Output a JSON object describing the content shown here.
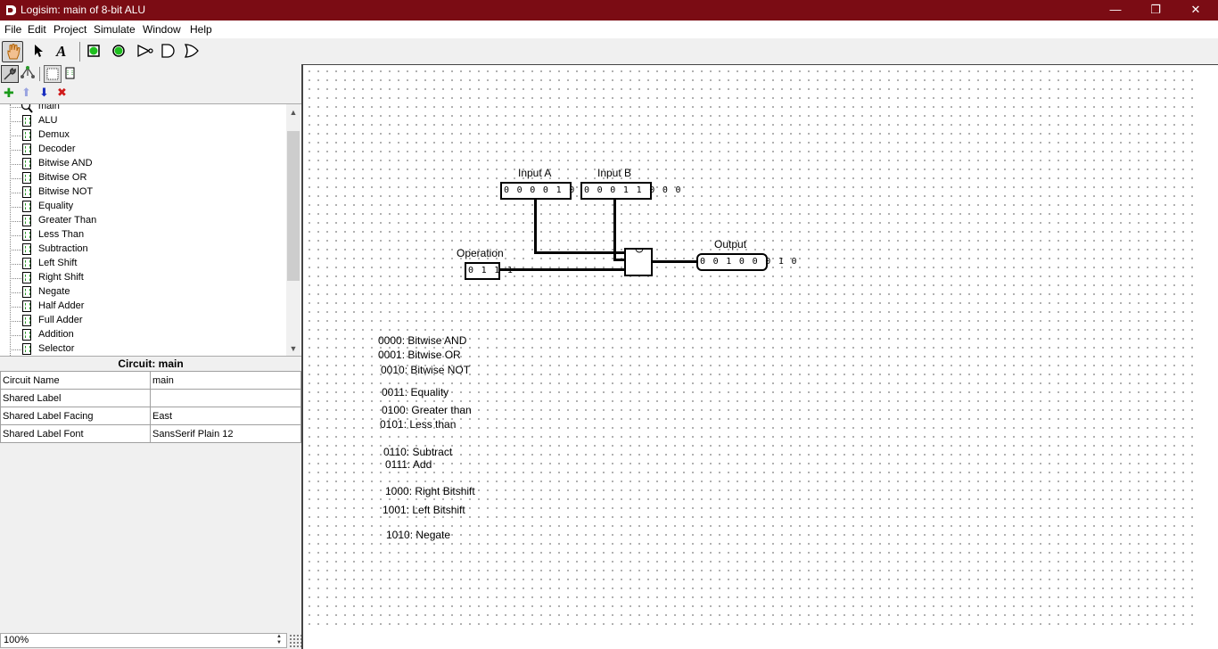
{
  "window": {
    "title": "Logisim: main of 8-bit ALU",
    "minimize": "—",
    "maximize": "❐",
    "close": "✕"
  },
  "menu": [
    "File",
    "Edit",
    "Project",
    "Simulate",
    "Window",
    "Help"
  ],
  "toolbar": {
    "tools": [
      "hand-poke-tool",
      "select-tool",
      "text-tool",
      "input-pin-tool",
      "output-pin-tool",
      "not-gate-tool",
      "and-gate-tool",
      "or-gate-tool"
    ],
    "text_tool_glyph": "A"
  },
  "explorer_toolbar": {
    "add": "✚",
    "up": "⬆",
    "down": "⬇",
    "delete": "✖"
  },
  "tree": {
    "items": [
      "main",
      "ALU",
      "Demux",
      "Decoder",
      "Bitwise AND",
      "Bitwise OR",
      "Bitwise NOT",
      "Equality",
      "Greater Than",
      "Less Than",
      "Subtraction",
      "Left Shift",
      "Right Shift",
      "Negate",
      "Half Adder",
      "Full Adder",
      "Addition",
      "Selector"
    ]
  },
  "properties": {
    "title": "Circuit: main",
    "rows": [
      {
        "key": "Circuit Name",
        "value": "main"
      },
      {
        "key": "Shared Label",
        "value": ""
      },
      {
        "key": "Shared Label Facing",
        "value": "East"
      },
      {
        "key": "Shared Label Font",
        "value": "SansSerif Plain 12"
      }
    ]
  },
  "zoom": "100%",
  "circuit": {
    "input_a": {
      "label": "Input A",
      "value": "0 0 0 0 1 0 1 0"
    },
    "input_b": {
      "label": "Input B",
      "value": "0 0 0 1 1 0 0 0"
    },
    "operation": {
      "label": "Operation",
      "value": "0 1 1 1"
    },
    "output": {
      "label": "Output",
      "value": "0 0 1 0 0 0 1 0"
    }
  },
  "notes": [
    "0000: Bitwise AND",
    "0001: Bitwise OR",
    "0010: Bitwise NOT",
    "0011: Equality",
    "0100: Greater than",
    "0101: Less than",
    "0110: Subtract",
    "0111: Add",
    "1000: Right Bitshift",
    "1001: Left Bitshift",
    "1010: Negate"
  ]
}
